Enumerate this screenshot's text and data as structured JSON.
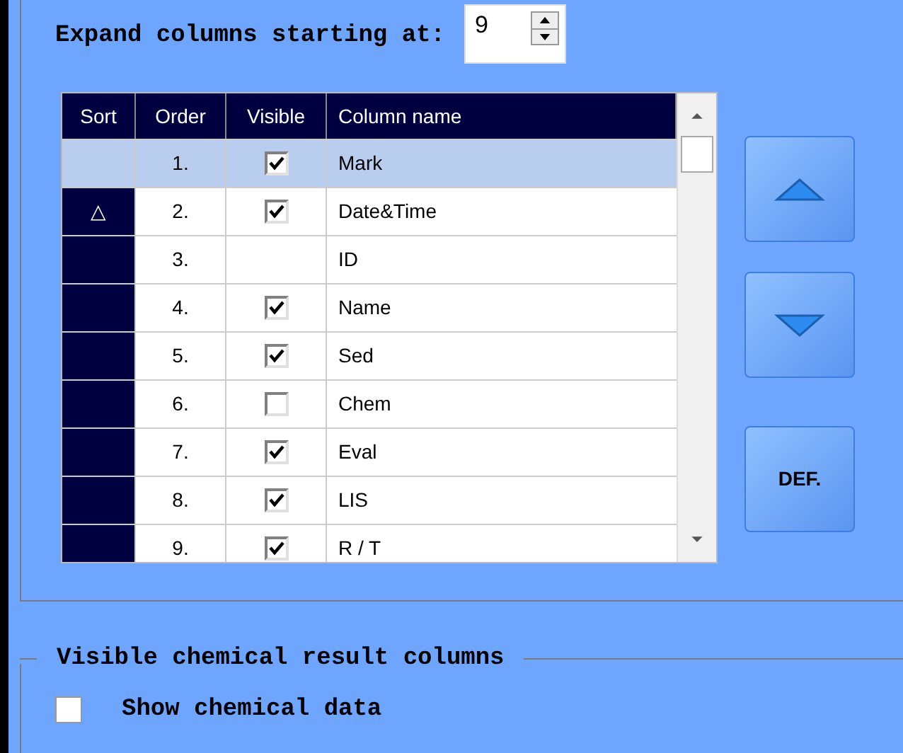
{
  "expand": {
    "label": "Expand columns starting at:",
    "value": "9"
  },
  "table": {
    "columns": [
      "Sort",
      "Order",
      "Visible",
      "Column name"
    ],
    "rows": [
      {
        "sort": "",
        "order": "1.",
        "kind": "checkbox",
        "visible": true,
        "name": "Mark",
        "selected": true
      },
      {
        "sort": "△",
        "order": "2.",
        "kind": "checkbox",
        "visible": true,
        "name": "Date&Time",
        "selected": false
      },
      {
        "sort": "",
        "order": "3.",
        "kind": "blank",
        "name": "ID",
        "selected": false
      },
      {
        "sort": "",
        "order": "4.",
        "kind": "checkbox",
        "visible": true,
        "name": "Name",
        "selected": false
      },
      {
        "sort": "",
        "order": "5.",
        "kind": "checkbox",
        "visible": true,
        "name": "Sed",
        "selected": false
      },
      {
        "sort": "",
        "order": "6.",
        "kind": "checkbox",
        "visible": false,
        "name": "Chem",
        "selected": false
      },
      {
        "sort": "",
        "order": "7.",
        "kind": "checkbox",
        "visible": true,
        "name": "Eval",
        "selected": false
      },
      {
        "sort": "",
        "order": "8.",
        "kind": "checkbox",
        "visible": true,
        "name": "LIS",
        "selected": false
      },
      {
        "sort": "",
        "order": "9.",
        "kind": "checkbox",
        "visible": true,
        "name": "R / T",
        "selected": false
      }
    ]
  },
  "def_button": "DEF.",
  "chem_group": {
    "title": "Visible chemical result columns",
    "show_label": "Show chemical data",
    "checked": false
  }
}
